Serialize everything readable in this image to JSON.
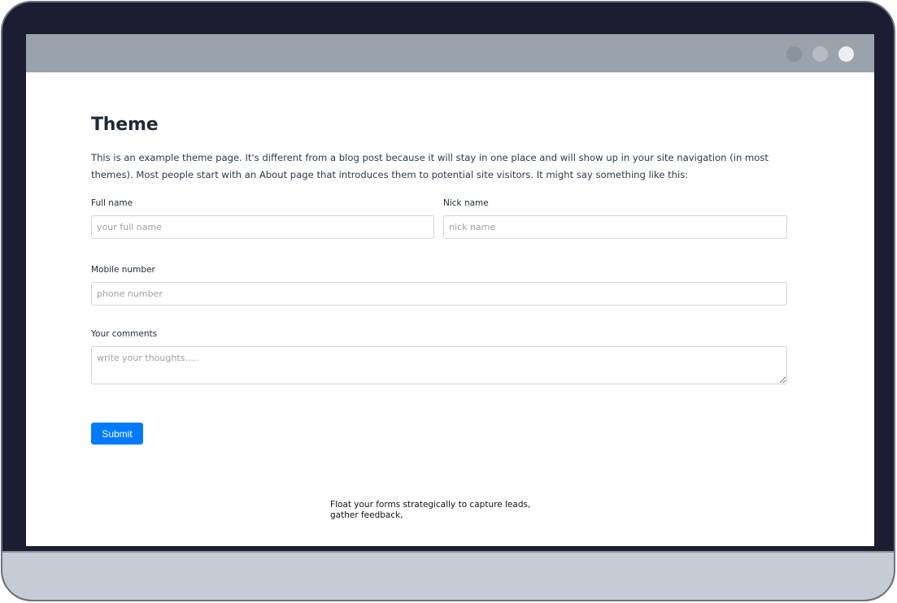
{
  "page": {
    "title": "Theme",
    "intro": "This is an example theme page. It's different from a blog post because it will stay in one place and will show up in your site navigation (in most themes). Most people start with an About page that introduces them to potential site visitors. It might say something like this:"
  },
  "form": {
    "full_name": {
      "label": "Full name",
      "placeholder": "your full name"
    },
    "nick_name": {
      "label": "Nick name",
      "placeholder": "nick name"
    },
    "mobile": {
      "label": "Mobile number",
      "placeholder": "phone number"
    },
    "comments": {
      "label": "Your comments",
      "placeholder": "write your thoughts....."
    },
    "submit_label": "Submit"
  },
  "footer": {
    "note": "Float your forms strategically to capture leads, gather feedback,"
  },
  "colors": {
    "accent": "#007bff",
    "frame": "#1c1c32",
    "browser_bar": "#9aa2ad"
  }
}
